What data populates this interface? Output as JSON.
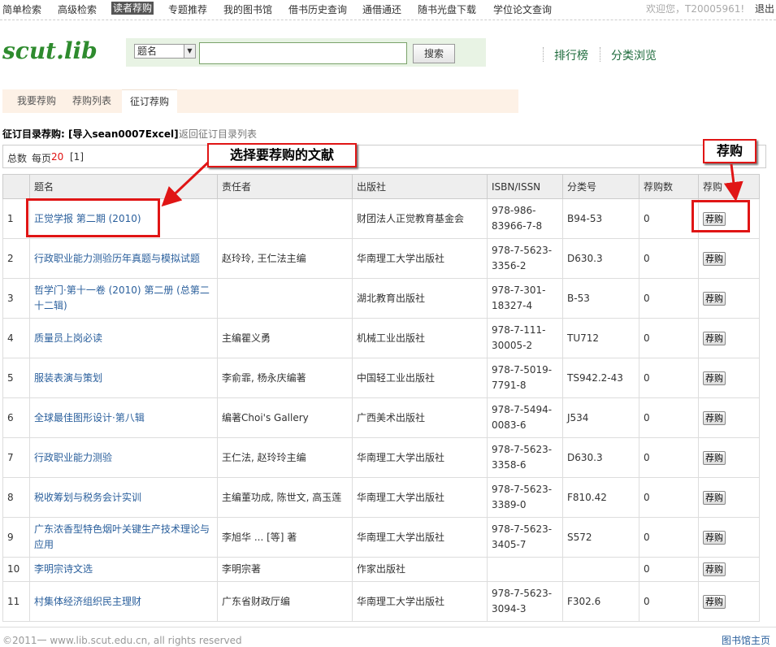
{
  "topnav": {
    "items": [
      "简单检索",
      "高级检索",
      "读者荐购",
      "专题推荐",
      "我的图书馆",
      "借书历史查询",
      "通借通还",
      "随书光盘下载",
      "学位论文查询"
    ],
    "welcome": "欢迎您，T20005961!",
    "logout": "退出"
  },
  "header": {
    "logo": "scut.lib",
    "search": {
      "field_selected": "题名",
      "query": "",
      "button_label": "搜索"
    },
    "links": [
      "排行榜",
      "分类浏览"
    ]
  },
  "tabs": [
    "我要荐购",
    "荐购列表",
    "征订荐购"
  ],
  "section": {
    "title": "征订目录荐购: [导入sean0007Excel]",
    "back_link": "返回征订目录列表"
  },
  "summary": {
    "total_label": "总数",
    "per_page_label": "每页",
    "per_page_value": "20",
    "pages": "[1]"
  },
  "table": {
    "headers": [
      "",
      "题名",
      "责任者",
      "出版社",
      "ISBN/ISSN",
      "分类号",
      "荐购数",
      "荐购"
    ],
    "button_label": "荐购",
    "rows": [
      {
        "no": "1",
        "title": "正觉学报 第二期 (2010)",
        "author": "",
        "publisher": "财团法人正觉教育基金会",
        "isbn": "978-986-83966-7-8",
        "class": "B94-53",
        "count": "0"
      },
      {
        "no": "2",
        "title": "行政职业能力测验历年真题与模拟试题",
        "author": "赵玲玲, 王仁法主编",
        "publisher": "华南理工大学出版社",
        "isbn": "978-7-5623-3356-2",
        "class": "D630.3",
        "count": "0"
      },
      {
        "no": "3",
        "title": "哲学门·第十一卷 (2010) 第二册 (总第二十二辑)",
        "author": "",
        "publisher": "湖北教育出版社",
        "isbn": "978-7-301-18327-4",
        "class": "B-53",
        "count": "0"
      },
      {
        "no": "4",
        "title": "质量员上岗必读",
        "author": "主编瞿义勇",
        "publisher": "机械工业出版社",
        "isbn": "978-7-111-30005-2",
        "class": "TU712",
        "count": "0"
      },
      {
        "no": "5",
        "title": "服装表演与策划",
        "author": "李俞霏, 杨永庆编著",
        "publisher": "中国轻工业出版社",
        "isbn": "978-7-5019-7791-8",
        "class": "TS942.2-43",
        "count": "0"
      },
      {
        "no": "6",
        "title": "全球最佳图形设计·第八辑",
        "author": "编著Choi's Gallery",
        "publisher": "广西美术出版社",
        "isbn": "978-7-5494-0083-6",
        "class": "J534",
        "count": "0"
      },
      {
        "no": "7",
        "title": "行政职业能力测验",
        "author": "王仁法, 赵玲玲主编",
        "publisher": "华南理工大学出版社",
        "isbn": "978-7-5623-3358-6",
        "class": "D630.3",
        "count": "0"
      },
      {
        "no": "8",
        "title": "税收筹划与税务会计实训",
        "author": "主编董功成, 陈世文, 高玉莲",
        "publisher": "华南理工大学出版社",
        "isbn": "978-7-5623-3389-0",
        "class": "F810.42",
        "count": "0"
      },
      {
        "no": "9",
        "title": "广东浓香型特色烟叶关键生产技术理论与应用",
        "author": "李旭华 ... [等] 著",
        "publisher": "华南理工大学出版社",
        "isbn": "978-7-5623-3405-7",
        "class": "S572",
        "count": "0"
      },
      {
        "no": "10",
        "title": "李明宗诗文选",
        "author": "李明宗著",
        "publisher": "作家出版社",
        "isbn": "",
        "class": "",
        "count": "0"
      },
      {
        "no": "11",
        "title": "村集体经济组织民主理财",
        "author": "广东省财政厅编",
        "publisher": "华南理工大学出版社",
        "isbn": "978-7-5623-3094-3",
        "class": "F302.6",
        "count": "0"
      }
    ]
  },
  "annotations": {
    "select_doc": "选择要荐购的文献",
    "recommend": "荐购"
  },
  "footer": {
    "copyright": "©2011一 www.lib.scut.edu.cn, all rights reserved",
    "home_link": "图书馆主页"
  },
  "colors": {
    "accent_green": "#2e8b2e",
    "link_blue": "#2a5f9c",
    "annotation_red": "#e01515"
  }
}
